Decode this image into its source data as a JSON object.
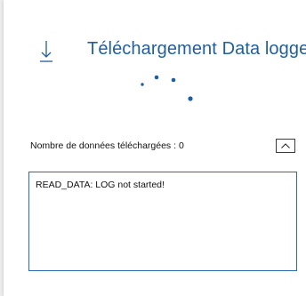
{
  "header": {
    "icon": "download-arrow-icon",
    "title": "Téléchargement Data logger",
    "title_color": "#1f5f9f"
  },
  "spinner": {
    "icon": "loading-dots-icon",
    "color": "#1f5f9f"
  },
  "download": {
    "count_label": "Nombre de données téléchargées : 0",
    "collapse_icon": "chevron-up-icon"
  },
  "log": {
    "text": "READ_DATA: LOG not started!",
    "border_color": "#2b6cb0"
  }
}
